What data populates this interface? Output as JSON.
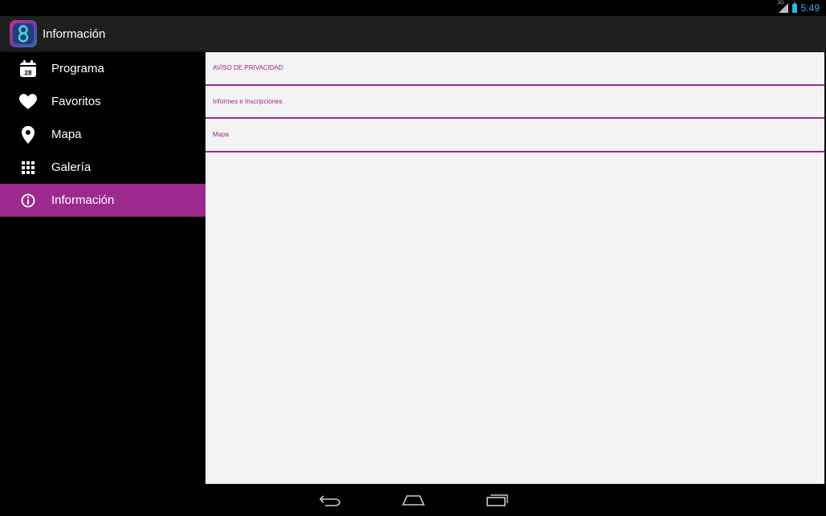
{
  "status_bar": {
    "network": "3G",
    "clock": "5:49"
  },
  "action_bar": {
    "title": "Información"
  },
  "drawer": {
    "items": [
      {
        "label": "Programa",
        "icon": "calendar-icon",
        "badge": "28",
        "active": false
      },
      {
        "label": "Favoritos",
        "icon": "heart-icon",
        "active": false
      },
      {
        "label": "Mapa",
        "icon": "map-pin-icon",
        "active": false
      },
      {
        "label": "Galería",
        "icon": "grid-icon",
        "active": false
      },
      {
        "label": "Información",
        "icon": "info-icon",
        "active": true
      }
    ]
  },
  "content": {
    "items": [
      {
        "label": "AVISO DE PRIVACIDAD"
      },
      {
        "label": "Informes e Inscripciones"
      },
      {
        "label": "Mapa"
      }
    ]
  },
  "colors": {
    "accent": "#9c2a8e",
    "content_bg": "#f3f3f3",
    "status_blue": "#33b5e5"
  }
}
